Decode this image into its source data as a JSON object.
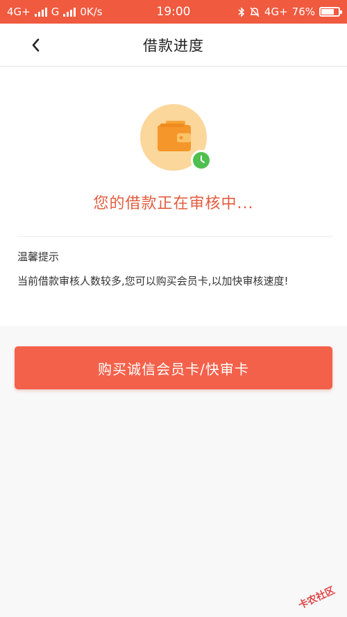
{
  "status_bar": {
    "network1": "4G+",
    "network2": "G",
    "speed": "0K/s",
    "time": "19:00",
    "network3": "4G+",
    "battery_text": "76%",
    "battery_level": 0.76,
    "icons": [
      "signal-icon",
      "bluetooth-icon",
      "alarm-off-icon",
      "battery-icon"
    ]
  },
  "nav": {
    "title": "借款进度",
    "back_icon": "chevron-left-icon"
  },
  "progress": {
    "illustration": "wallet-clock-icon",
    "status_text": "您的借款正在审核中...",
    "tip_title": "温馨提示",
    "tip_body": "当前借款审核人数较多,您可以购买会员卡,以加快审核速度!"
  },
  "cta": {
    "label": "购买诚信会员卡/快审卡"
  },
  "colors": {
    "accent": "#f05a3f",
    "button": "#f4614a",
    "status_text": "#e25c3e",
    "wallet": "#f5962a",
    "clock": "#4fbf50"
  },
  "watermark": {
    "text": "卡农社区"
  }
}
